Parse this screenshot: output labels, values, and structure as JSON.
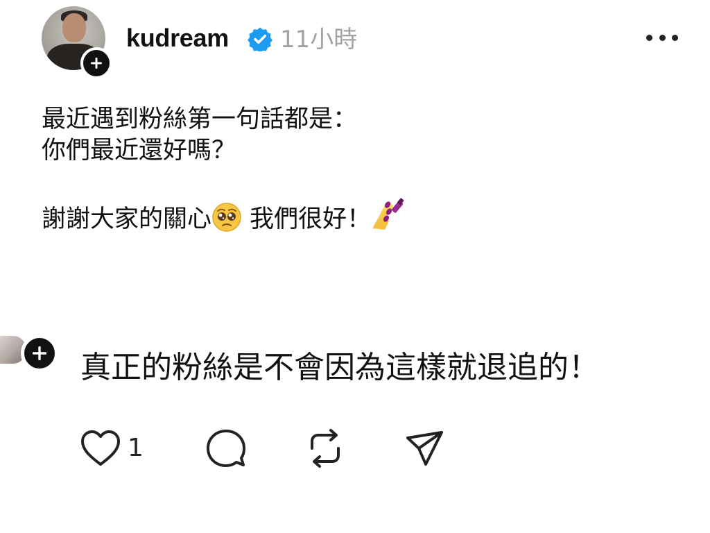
{
  "post": {
    "username": "kudream",
    "verified": true,
    "timestamp": "11小時",
    "avatar_icon": "profile-photo",
    "follow_icon": "plus-icon",
    "more_icon": "more-horizontal-icon",
    "body_lines": [
      "最近遇到粉絲第一句話都是：",
      "你們最近還好嗎？",
      "",
      "謝謝大家的關心",
      "我們很好！"
    ],
    "emojis": [
      "pleading-face",
      "nail-polish"
    ]
  },
  "reply": {
    "text": "真正的粉絲是不會因為這樣就退追的！",
    "follow_icon": "plus-icon"
  },
  "actions": {
    "like_icon": "heart-icon",
    "like_count": "1",
    "comment_icon": "comment-icon",
    "repost_icon": "repost-icon",
    "share_icon": "send-icon"
  },
  "colors": {
    "verified_blue": "#1d9bf0",
    "timestamp_gray": "#a3a3a3"
  }
}
